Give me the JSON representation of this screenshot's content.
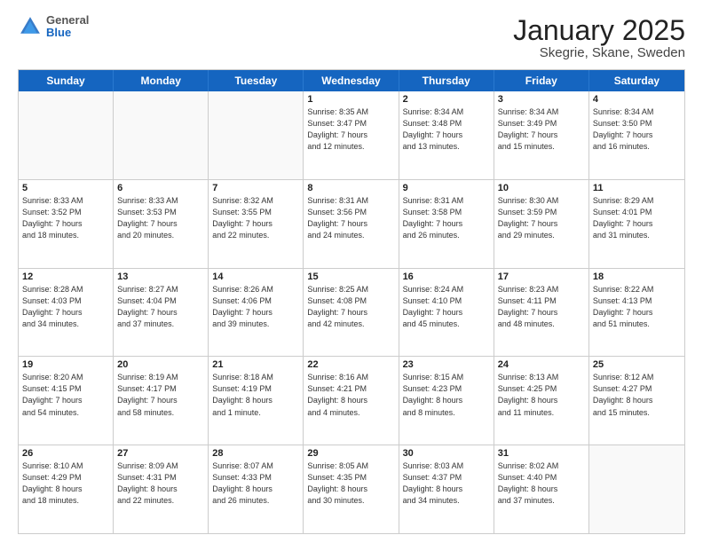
{
  "header": {
    "logo": {
      "general": "General",
      "blue": "Blue"
    },
    "title": "January 2025",
    "subtitle": "Skegrie, Skane, Sweden"
  },
  "weekdays": [
    "Sunday",
    "Monday",
    "Tuesday",
    "Wednesday",
    "Thursday",
    "Friday",
    "Saturday"
  ],
  "weeks": [
    [
      {
        "day": "",
        "info": ""
      },
      {
        "day": "",
        "info": ""
      },
      {
        "day": "",
        "info": ""
      },
      {
        "day": "1",
        "info": "Sunrise: 8:35 AM\nSunset: 3:47 PM\nDaylight: 7 hours\nand 12 minutes."
      },
      {
        "day": "2",
        "info": "Sunrise: 8:34 AM\nSunset: 3:48 PM\nDaylight: 7 hours\nand 13 minutes."
      },
      {
        "day": "3",
        "info": "Sunrise: 8:34 AM\nSunset: 3:49 PM\nDaylight: 7 hours\nand 15 minutes."
      },
      {
        "day": "4",
        "info": "Sunrise: 8:34 AM\nSunset: 3:50 PM\nDaylight: 7 hours\nand 16 minutes."
      }
    ],
    [
      {
        "day": "5",
        "info": "Sunrise: 8:33 AM\nSunset: 3:52 PM\nDaylight: 7 hours\nand 18 minutes."
      },
      {
        "day": "6",
        "info": "Sunrise: 8:33 AM\nSunset: 3:53 PM\nDaylight: 7 hours\nand 20 minutes."
      },
      {
        "day": "7",
        "info": "Sunrise: 8:32 AM\nSunset: 3:55 PM\nDaylight: 7 hours\nand 22 minutes."
      },
      {
        "day": "8",
        "info": "Sunrise: 8:31 AM\nSunset: 3:56 PM\nDaylight: 7 hours\nand 24 minutes."
      },
      {
        "day": "9",
        "info": "Sunrise: 8:31 AM\nSunset: 3:58 PM\nDaylight: 7 hours\nand 26 minutes."
      },
      {
        "day": "10",
        "info": "Sunrise: 8:30 AM\nSunset: 3:59 PM\nDaylight: 7 hours\nand 29 minutes."
      },
      {
        "day": "11",
        "info": "Sunrise: 8:29 AM\nSunset: 4:01 PM\nDaylight: 7 hours\nand 31 minutes."
      }
    ],
    [
      {
        "day": "12",
        "info": "Sunrise: 8:28 AM\nSunset: 4:03 PM\nDaylight: 7 hours\nand 34 minutes."
      },
      {
        "day": "13",
        "info": "Sunrise: 8:27 AM\nSunset: 4:04 PM\nDaylight: 7 hours\nand 37 minutes."
      },
      {
        "day": "14",
        "info": "Sunrise: 8:26 AM\nSunset: 4:06 PM\nDaylight: 7 hours\nand 39 minutes."
      },
      {
        "day": "15",
        "info": "Sunrise: 8:25 AM\nSunset: 4:08 PM\nDaylight: 7 hours\nand 42 minutes."
      },
      {
        "day": "16",
        "info": "Sunrise: 8:24 AM\nSunset: 4:10 PM\nDaylight: 7 hours\nand 45 minutes."
      },
      {
        "day": "17",
        "info": "Sunrise: 8:23 AM\nSunset: 4:11 PM\nDaylight: 7 hours\nand 48 minutes."
      },
      {
        "day": "18",
        "info": "Sunrise: 8:22 AM\nSunset: 4:13 PM\nDaylight: 7 hours\nand 51 minutes."
      }
    ],
    [
      {
        "day": "19",
        "info": "Sunrise: 8:20 AM\nSunset: 4:15 PM\nDaylight: 7 hours\nand 54 minutes."
      },
      {
        "day": "20",
        "info": "Sunrise: 8:19 AM\nSunset: 4:17 PM\nDaylight: 7 hours\nand 58 minutes."
      },
      {
        "day": "21",
        "info": "Sunrise: 8:18 AM\nSunset: 4:19 PM\nDaylight: 8 hours\nand 1 minute."
      },
      {
        "day": "22",
        "info": "Sunrise: 8:16 AM\nSunset: 4:21 PM\nDaylight: 8 hours\nand 4 minutes."
      },
      {
        "day": "23",
        "info": "Sunrise: 8:15 AM\nSunset: 4:23 PM\nDaylight: 8 hours\nand 8 minutes."
      },
      {
        "day": "24",
        "info": "Sunrise: 8:13 AM\nSunset: 4:25 PM\nDaylight: 8 hours\nand 11 minutes."
      },
      {
        "day": "25",
        "info": "Sunrise: 8:12 AM\nSunset: 4:27 PM\nDaylight: 8 hours\nand 15 minutes."
      }
    ],
    [
      {
        "day": "26",
        "info": "Sunrise: 8:10 AM\nSunset: 4:29 PM\nDaylight: 8 hours\nand 18 minutes."
      },
      {
        "day": "27",
        "info": "Sunrise: 8:09 AM\nSunset: 4:31 PM\nDaylight: 8 hours\nand 22 minutes."
      },
      {
        "day": "28",
        "info": "Sunrise: 8:07 AM\nSunset: 4:33 PM\nDaylight: 8 hours\nand 26 minutes."
      },
      {
        "day": "29",
        "info": "Sunrise: 8:05 AM\nSunset: 4:35 PM\nDaylight: 8 hours\nand 30 minutes."
      },
      {
        "day": "30",
        "info": "Sunrise: 8:03 AM\nSunset: 4:37 PM\nDaylight: 8 hours\nand 34 minutes."
      },
      {
        "day": "31",
        "info": "Sunrise: 8:02 AM\nSunset: 4:40 PM\nDaylight: 8 hours\nand 37 minutes."
      },
      {
        "day": "",
        "info": ""
      }
    ]
  ]
}
